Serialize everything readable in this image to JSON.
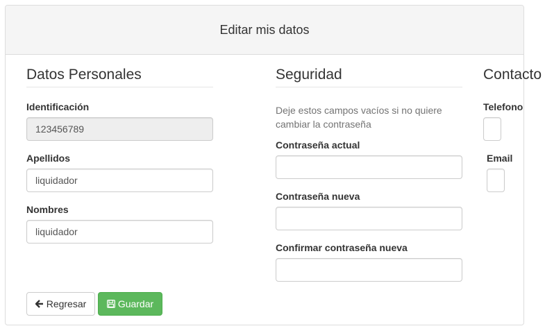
{
  "header": {
    "title": "Editar mis datos"
  },
  "personal": {
    "title": "Datos Personales",
    "identificacion_label": "Identificación",
    "identificacion_value": "123456789",
    "apellidos_label": "Apellidos",
    "apellidos_value": "liquidador",
    "nombres_label": "Nombres",
    "nombres_value": "liquidador"
  },
  "seguridad": {
    "title": "Seguridad",
    "help_line1": "Deje estos campos vacíos si no quiere",
    "help_line2": "cambiar la contraseña",
    "actual_label": "Contraseña actual",
    "nueva_label": "Contraseña nueva",
    "confirmar_label": "Confirmar contraseña nueva"
  },
  "contacto": {
    "title": "Contacto",
    "telefono_label": "Telefono",
    "email_label": "Email"
  },
  "buttons": {
    "back_label": "Regresar",
    "save_label": "Guardar",
    "back_icon": "arrow-left-icon",
    "save_icon": "floppy-disk-icon"
  },
  "colors": {
    "success": "#5cb85c",
    "heading_bg": "#f5f5f5"
  }
}
